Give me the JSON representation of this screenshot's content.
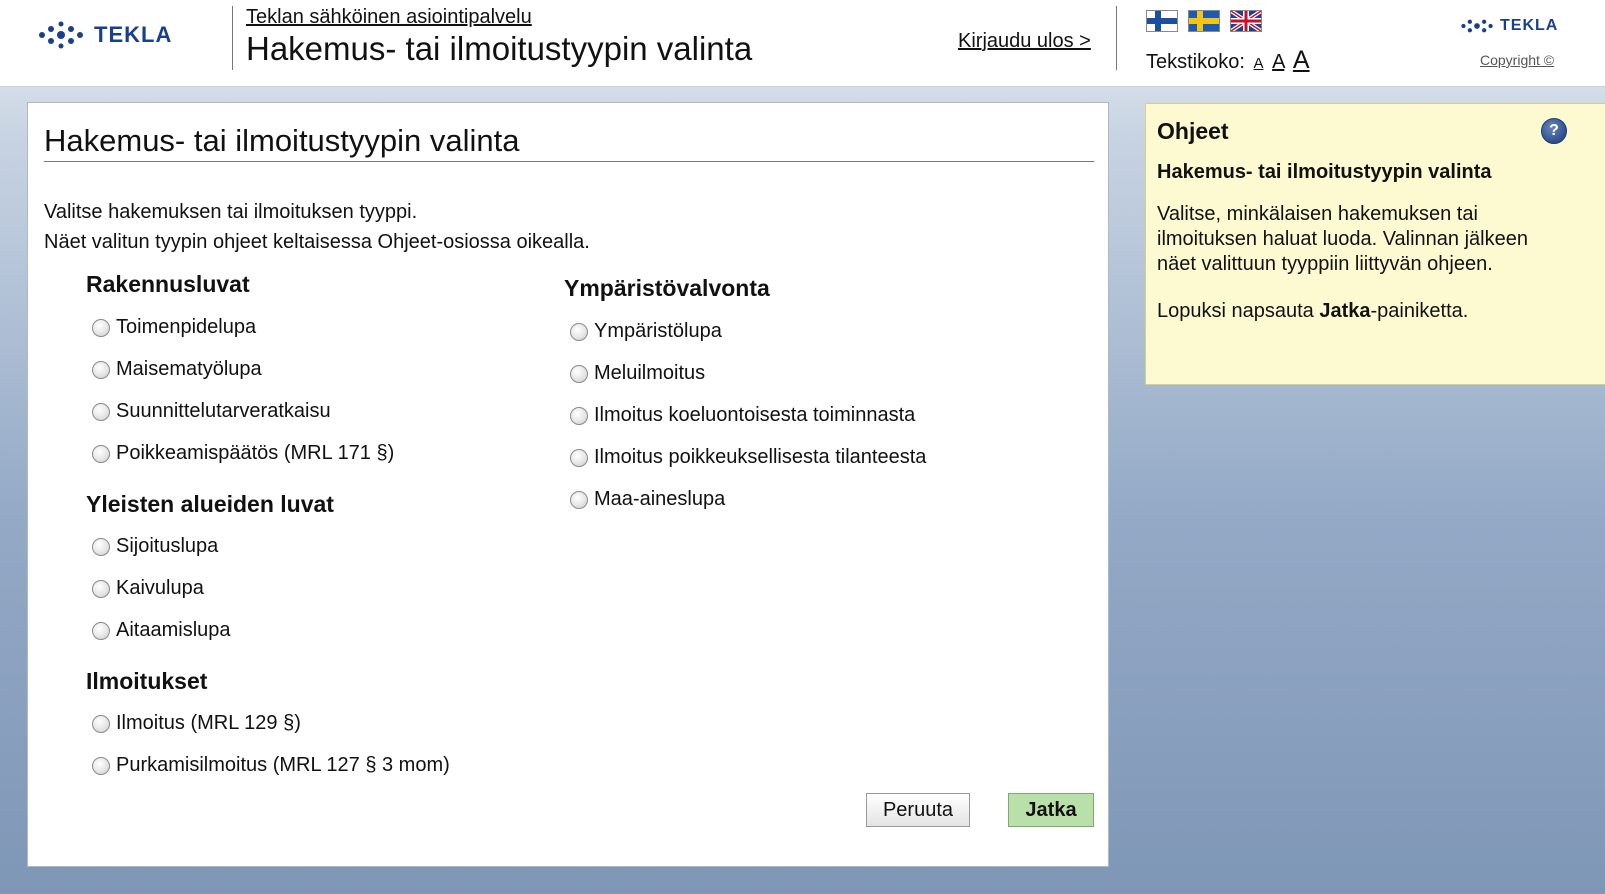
{
  "header": {
    "logo_text": "TEKLA",
    "service_link": "Teklan sähköinen asiointipalvelu",
    "title": "Hakemus- tai ilmoitustyypin valinta",
    "logout": "Kirjaudu ulos >",
    "text_size_label": "Tekstikoko:",
    "text_sizes": [
      "A",
      "A",
      "A"
    ],
    "copyright": "Copyright ©"
  },
  "panel": {
    "title": "Hakemus- tai ilmoitustyypin valinta",
    "intro_line1": "Valitse hakemuksen tai ilmoituksen tyyppi.",
    "intro_line2": "Näet valitun tyypin ohjeet keltaisessa Ohjeet-osiossa oikealla.",
    "groups": [
      {
        "title": "Rakennusluvat",
        "options": [
          "Toimenpidelupa",
          "Maisematyölupa",
          "Suunnittelutarveratkaisu",
          "Poikkeamispäätös (MRL 171 §)"
        ]
      },
      {
        "title": "Yleisten alueiden luvat",
        "options": [
          "Sijoituslupa",
          "Kaivulupa",
          "Aitaamislupa"
        ]
      },
      {
        "title": "Ilmoitukset",
        "options": [
          "Ilmoitus (MRL 129 §)",
          "Purkamisilmoitus (MRL 127 § 3 mom)"
        ]
      },
      {
        "title": "Ympäristövalvonta",
        "options": [
          "Ympäristölupa",
          "Meluilmoitus",
          "Ilmoitus koeluontoisesta toiminnasta",
          "Ilmoitus poikkeuksellisesta tilanteesta",
          "Maa-aineslupa"
        ]
      }
    ],
    "cancel_label": "Peruuta",
    "continue_label": "Jatka"
  },
  "help": {
    "title": "Ohjeet",
    "subtitle": "Hakemus- tai ilmoitustyypin valinta",
    "text": "Valitse, minkälaisen hakemuksen tai ilmoituksen haluat luoda. Valinnan jälkeen näet valittuun tyyppiin liittyvän ohjeen.",
    "text2_prefix": "Lopuksi napsauta ",
    "text2_bold": "Jatka",
    "text2_suffix": "-painiketta."
  },
  "colors": {
    "brand_blue": "#1a3f8c",
    "continue_button": "#b8e0a8",
    "help_background": "#fdfad2"
  }
}
